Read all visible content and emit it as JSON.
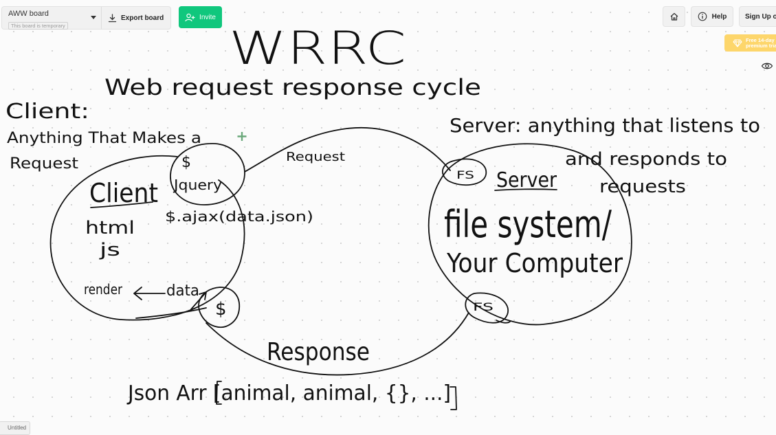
{
  "toolbar": {
    "board_name": "AWW board",
    "board_badge": "This board is temporary",
    "export_label": "Export board",
    "invite_label": "Invite"
  },
  "top_right": {
    "help_label": "Help",
    "signup_label": "Sign Up or Log In"
  },
  "premium": {
    "line1": "Free 14-day",
    "line2": "premium trial"
  },
  "colors": {
    "accent": "#10c77d",
    "premium": "#fdd66b",
    "ink": "#111111"
  },
  "drawing": {
    "title": "WRRC",
    "subtitle": "Web request response cycle",
    "client_def_1": "Client:",
    "client_def_2": "Anything That Makes a",
    "client_def_3": "Request",
    "client_label": "Client",
    "html": "html",
    "js": "js",
    "dollar": "$",
    "jquery": "Jquery",
    "ajax": "$.ajax(data.json)",
    "render": "render",
    "data": "data",
    "request": "Request",
    "response": "Response",
    "server_def_1": "Server: anything that listens to",
    "server_def_2": "and responds to",
    "server_def_3": "requests",
    "server_label": "Server",
    "fs_top": "FS",
    "fs_bottom": "FS",
    "filesystem": "file system/",
    "your_computer": "Your Computer",
    "json_line": "Json Arr [animal, animal, {}, ...]"
  },
  "corner_tab": "Untitled"
}
